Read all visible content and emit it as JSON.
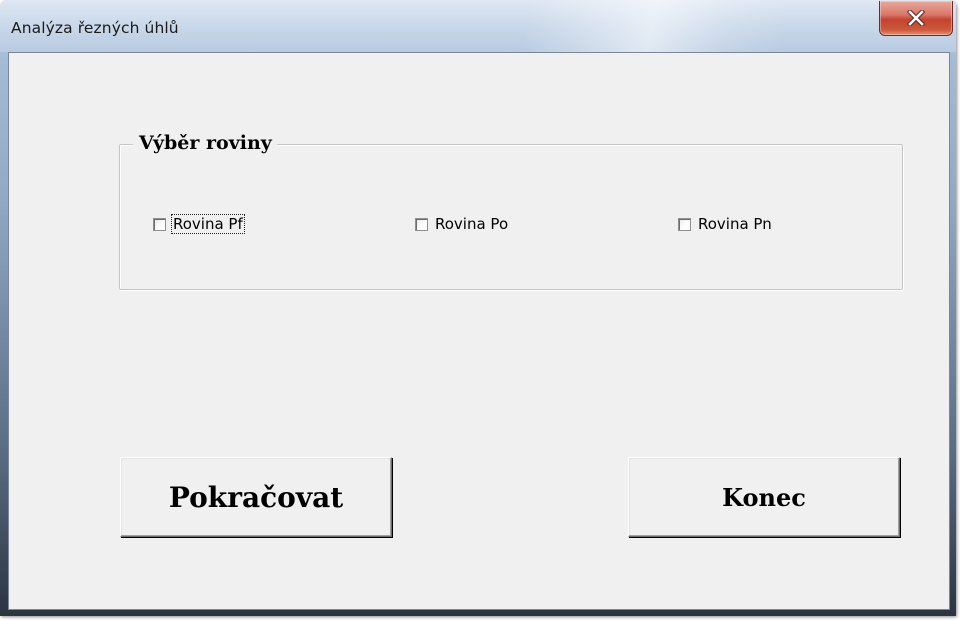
{
  "window": {
    "title": "Analýza řezných úhlů",
    "close_icon": "close-icon"
  },
  "plane_selection": {
    "legend": "Výběr roviny",
    "options": [
      {
        "label": "Rovina Pf",
        "checked": false,
        "focused": true
      },
      {
        "label": "Rovina Po",
        "checked": false,
        "focused": false
      },
      {
        "label": "Rovina Pn",
        "checked": false,
        "focused": false
      }
    ]
  },
  "buttons": {
    "continue_label": "Pokračovat",
    "end_label": "Konec"
  },
  "colors": {
    "client_background": "#f0f0f0",
    "close_button_red": "#c4432f"
  }
}
